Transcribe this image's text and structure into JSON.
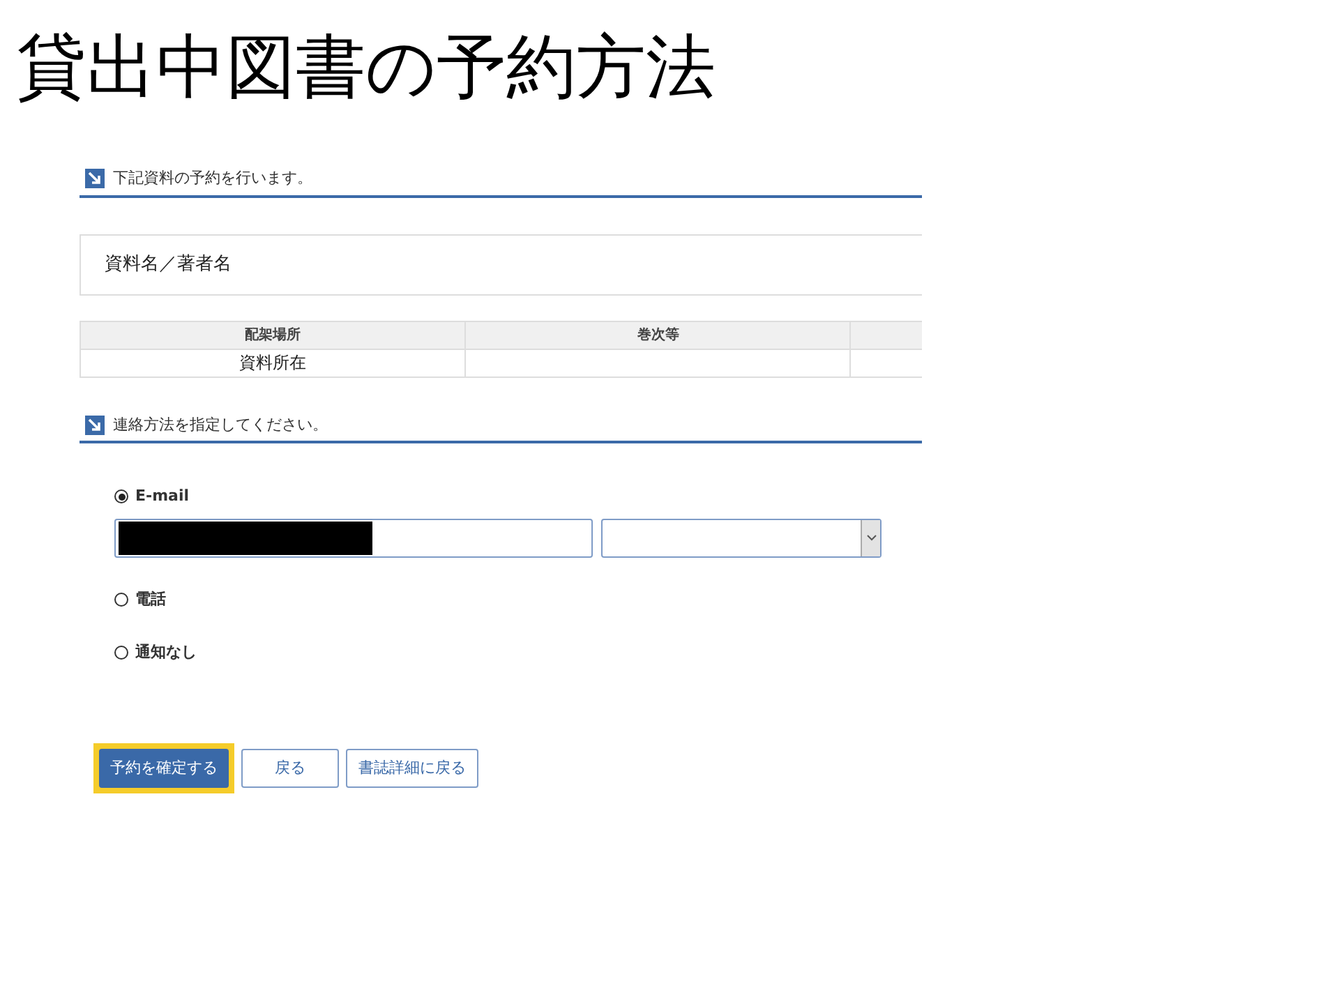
{
  "slide_title": "貸出中図書の予約方法",
  "item_section": {
    "heading": "下記資料の予約を行います。",
    "title_box": "資料名／著者名",
    "table": {
      "columns": [
        "配架場所",
        "巻次等",
        ""
      ],
      "rows": [
        [
          "資料所在",
          "",
          ""
        ]
      ]
    }
  },
  "contact_section": {
    "heading": "連絡方法を指定してください。",
    "options": [
      {
        "label": "E-mail",
        "selected": true,
        "kind": "email"
      },
      {
        "label": "電話",
        "selected": false,
        "kind": "plain"
      },
      {
        "label": "通知なし",
        "selected": false,
        "kind": "plain"
      }
    ],
    "email_redacted": true
  },
  "buttons": [
    {
      "label": "予約を確定する",
      "primary": true,
      "highlighted": true
    },
    {
      "label": "戻る",
      "primary": false,
      "highlighted": false
    },
    {
      "label": "書誌詳細に戻る",
      "primary": false,
      "highlighted": false
    }
  ]
}
